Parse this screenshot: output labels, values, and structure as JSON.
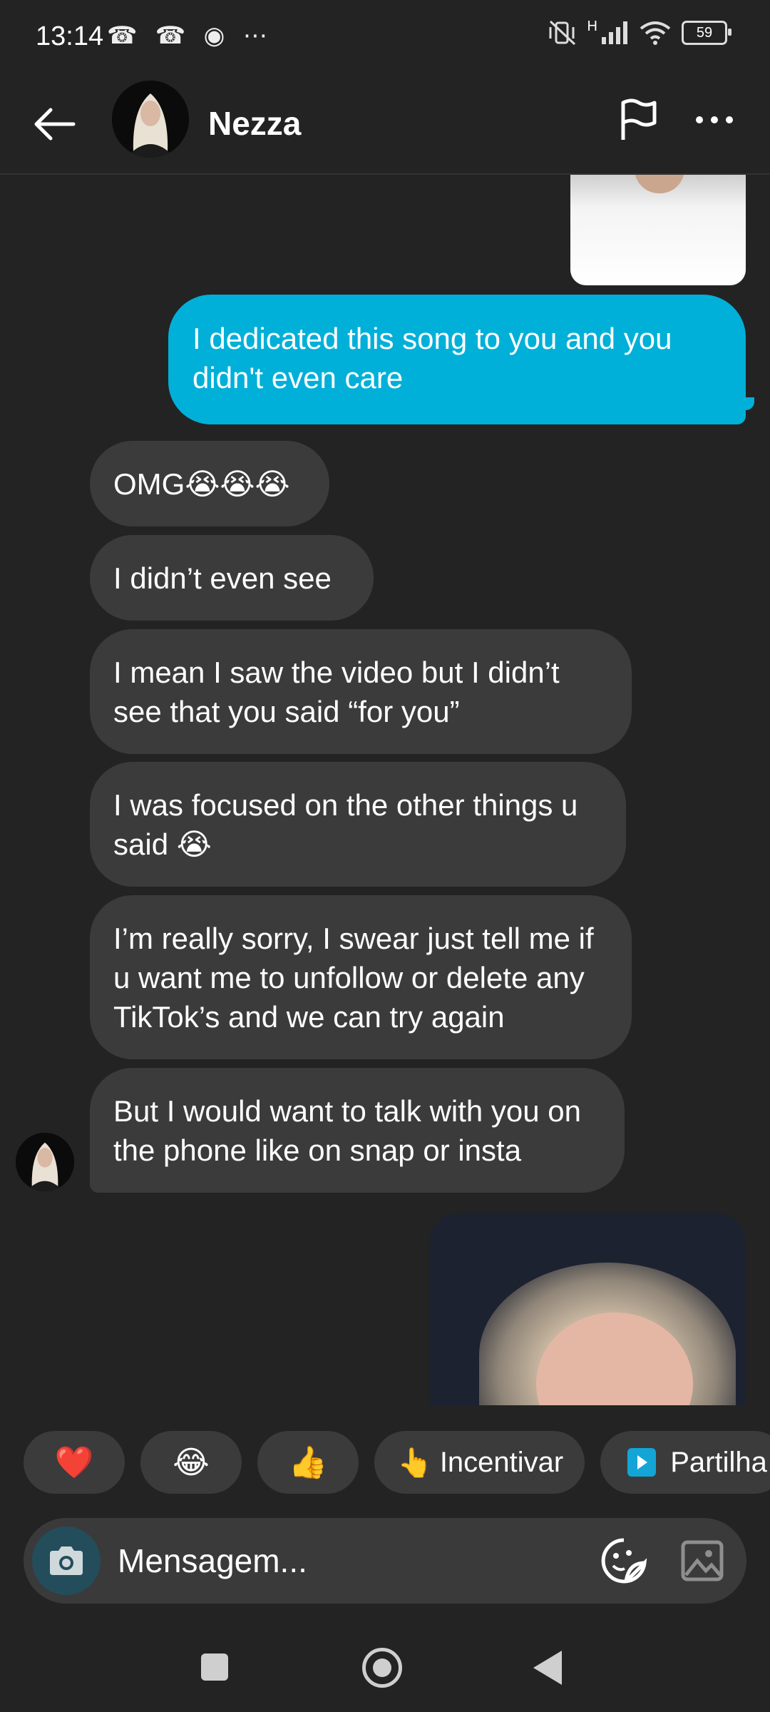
{
  "status_bar": {
    "time": "13:14",
    "left_icons": "☎ ☎ ◉ ⋯",
    "network": "H",
    "battery": "59"
  },
  "header": {
    "contact_name": "Nezza"
  },
  "messages": {
    "outgoing_1": "I dedicated this song to you and you didn't even care",
    "incoming": [
      "OMG😭😭😭",
      "I didn’t even see",
      "I mean I saw the video but I didn’t see that you said “for you”",
      "I was focused on the other things u said 😭",
      "I’m really sorry, I swear just tell me if u want me to unfollow or delete any TikTok’s and we can try again",
      "But I would want to talk with you on the phone like on snap or insta"
    ]
  },
  "reactions": {
    "heart": "❤️",
    "laugh": "😂",
    "thumbs_up": "👍",
    "nudge_emoji": "👆",
    "nudge_label": "Incentivar",
    "share_label": "Partilha"
  },
  "composer": {
    "placeholder": "Mensagem..."
  }
}
